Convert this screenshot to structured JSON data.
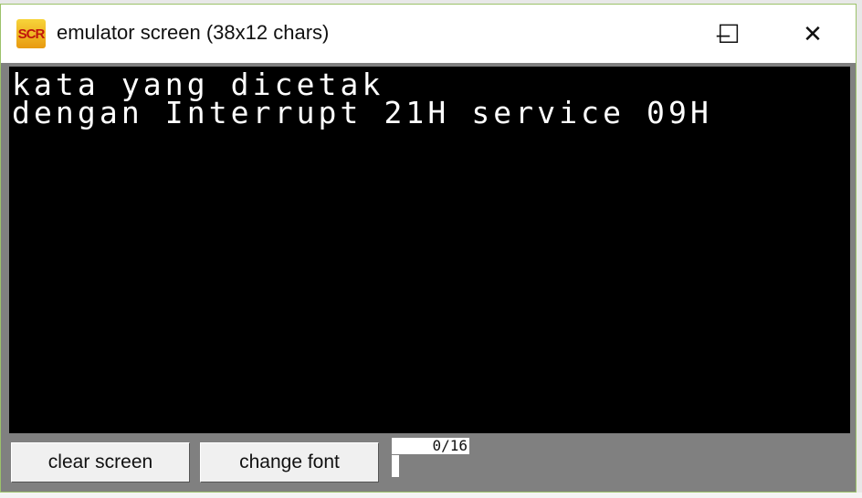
{
  "window": {
    "title": "emulator screen (38x12 chars)",
    "icon_label": "SCR",
    "icon_name": "emu8086-screen-icon",
    "controls": {
      "minimize": "–",
      "maximize": "☐",
      "close": "✕"
    }
  },
  "screen": {
    "lines": [
      "kata yang dicetak",
      "dengan Interrupt 21H service 09H"
    ],
    "background": "#000000",
    "foreground": "#ffffff"
  },
  "toolbar": {
    "clear_label": "clear screen",
    "font_label": "change font",
    "counter": "0/16"
  }
}
